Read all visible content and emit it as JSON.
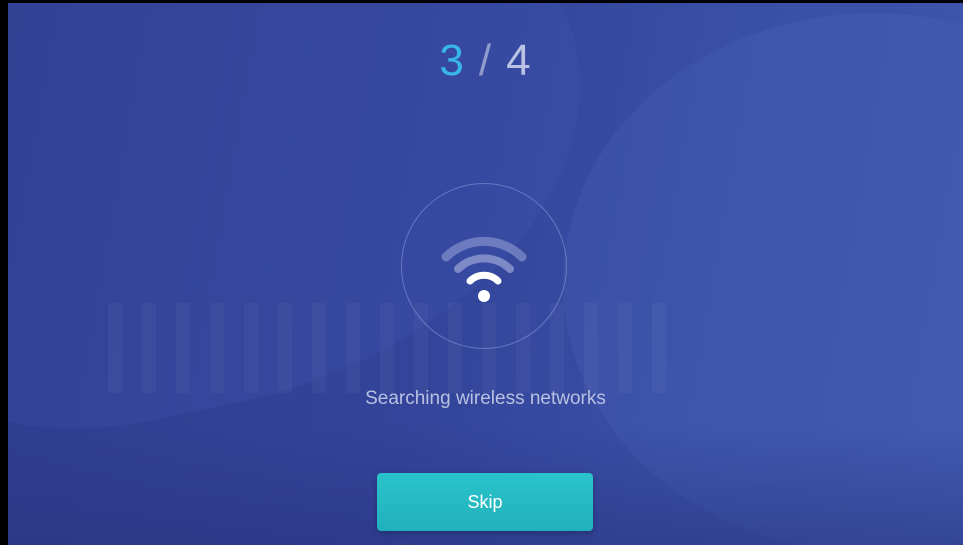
{
  "setup_wizard": {
    "step_current": "3",
    "step_separator": "/",
    "step_total": "4",
    "status_text": "Searching wireless networks",
    "skip_label": "Skip",
    "icon": "wifi-icon"
  },
  "colors": {
    "background": "#33449a",
    "step_current": "#39b6e8",
    "button": "#26b9c3",
    "text": "#b8c1e1"
  }
}
